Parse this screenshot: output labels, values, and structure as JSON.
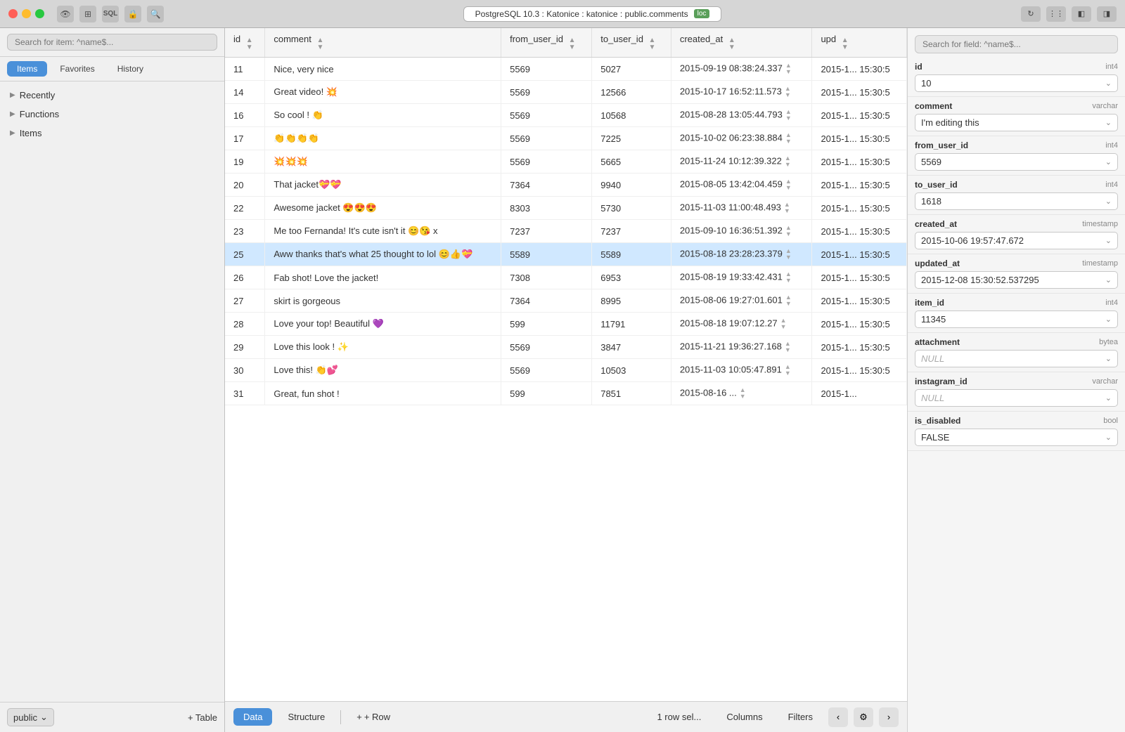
{
  "titlebar": {
    "title": "PostgreSQL 10.3 : Katonice : katonice : public.comments",
    "loc_label": "loc",
    "icons": [
      "hide",
      "layout",
      "sql",
      "lock",
      "search"
    ]
  },
  "sidebar": {
    "search_placeholder": "Search for item: ^name$...",
    "tabs": [
      "Items",
      "Favorites",
      "History"
    ],
    "active_tab": "Items",
    "sections": [
      {
        "label": "Recently",
        "expanded": false
      },
      {
        "label": "Functions",
        "expanded": false
      },
      {
        "label": "Items",
        "expanded": false
      }
    ],
    "schema": "public",
    "add_table": "+ Table"
  },
  "table": {
    "columns": [
      "id",
      "comment",
      "from_user_id",
      "to_user_id",
      "created_at",
      "upd"
    ],
    "rows": [
      {
        "id": 11,
        "comment": "Nice, very nice",
        "from_user_id": 5569,
        "to_user_id": 5027,
        "created_at": "2015-09-19 08:38:24.337",
        "upd": "2015-1... 15:30:5"
      },
      {
        "id": 14,
        "comment": "Great video! 💥",
        "from_user_id": 5569,
        "to_user_id": 12566,
        "created_at": "2015-10-17 16:52:11.573",
        "upd": "2015-1... 15:30:5"
      },
      {
        "id": 16,
        "comment": "So cool ! 👏",
        "from_user_id": 5569,
        "to_user_id": 10568,
        "created_at": "2015-08-28 13:05:44.793",
        "upd": "2015-1... 15:30:5"
      },
      {
        "id": 17,
        "comment": "👏👏👏👏",
        "from_user_id": 5569,
        "to_user_id": 7225,
        "created_at": "2015-10-02 06:23:38.884",
        "upd": "2015-1... 15:30:5"
      },
      {
        "id": 19,
        "comment": "💥💥💥",
        "from_user_id": 5569,
        "to_user_id": 5665,
        "created_at": "2015-11-24 10:12:39.322",
        "upd": "2015-1... 15:30:5"
      },
      {
        "id": 20,
        "comment": "That jacket💝💝",
        "from_user_id": 7364,
        "to_user_id": 9940,
        "created_at": "2015-08-05 13:42:04.459",
        "upd": "2015-1... 15:30:5"
      },
      {
        "id": 22,
        "comment": "Awesome jacket 😍😍😍",
        "from_user_id": 8303,
        "to_user_id": 5730,
        "created_at": "2015-11-03 11:00:48.493",
        "upd": "2015-1... 15:30:5"
      },
      {
        "id": 23,
        "comment": "Me too Fernanda! It's cute isn't it 😊😘 x",
        "from_user_id": 7237,
        "to_user_id": 7237,
        "created_at": "2015-09-10 16:36:51.392",
        "upd": "2015-1... 15:30:5"
      },
      {
        "id": 25,
        "comment": "Aww thanks that's what 25 thought to lol 😊👍💝",
        "from_user_id": 5589,
        "to_user_id": 5589,
        "created_at": "2015-08-18 23:28:23.379",
        "upd": "2015-1... 15:30:5",
        "selected": true
      },
      {
        "id": 26,
        "comment": "Fab shot! Love the jacket!",
        "from_user_id": 7308,
        "to_user_id": 6953,
        "created_at": "2015-08-19 19:33:42.431",
        "upd": "2015-1... 15:30:5"
      },
      {
        "id": 27,
        "comment": "skirt is gorgeous",
        "from_user_id": 7364,
        "to_user_id": 8995,
        "created_at": "2015-08-06 19:27:01.601",
        "upd": "2015-1... 15:30:5"
      },
      {
        "id": 28,
        "comment": "Love your top! Beautiful 💜",
        "from_user_id": 599,
        "to_user_id": 11791,
        "created_at": "2015-08-18 19:07:12.27",
        "upd": "2015-1... 15:30:5"
      },
      {
        "id": 29,
        "comment": "Love this look ! ✨",
        "from_user_id": 5569,
        "to_user_id": 3847,
        "created_at": "2015-11-21 19:36:27.168",
        "upd": "2015-1... 15:30:5"
      },
      {
        "id": 30,
        "comment": "Love this! 👏💕",
        "from_user_id": 5569,
        "to_user_id": 10503,
        "created_at": "2015-11-03 10:05:47.891",
        "upd": "2015-1... 15:30:5"
      },
      {
        "id": 31,
        "comment": "Great, fun shot !",
        "from_user_id": 599,
        "to_user_id": 7851,
        "created_at": "2015-08-16 ...",
        "upd": "2015-1..."
      }
    ]
  },
  "right_panel": {
    "search_placeholder": "Search for field: ^name$...",
    "fields": [
      {
        "name": "id",
        "type": "int4",
        "value": "10",
        "is_null": false
      },
      {
        "name": "comment",
        "type": "varchar",
        "value": "I'm editing this",
        "is_null": false
      },
      {
        "name": "from_user_id",
        "type": "int4",
        "value": "5569",
        "is_null": false
      },
      {
        "name": "to_user_id",
        "type": "int4",
        "value": "1618",
        "is_null": false
      },
      {
        "name": "created_at",
        "type": "timestamp",
        "value": "2015-10-06 19:57:47.672",
        "is_null": false
      },
      {
        "name": "updated_at",
        "type": "timestamp",
        "value": "2015-12-08 15:30:52.537295",
        "is_null": false
      },
      {
        "name": "item_id",
        "type": "int4",
        "value": "11345",
        "is_null": false
      },
      {
        "name": "attachment",
        "type": "bytea",
        "value": "NULL",
        "is_null": true
      },
      {
        "name": "instagram_id",
        "type": "varchar",
        "value": "NULL",
        "is_null": true
      },
      {
        "name": "is_disabled",
        "type": "bool",
        "value": "FALSE",
        "is_null": false
      }
    ]
  },
  "bottom_toolbar": {
    "tabs": [
      "Data",
      "Structure"
    ],
    "active_tab": "Data",
    "add_row": "+ Row",
    "row_selected": "1 row sel...",
    "columns": "Columns",
    "filters": "Filters"
  }
}
